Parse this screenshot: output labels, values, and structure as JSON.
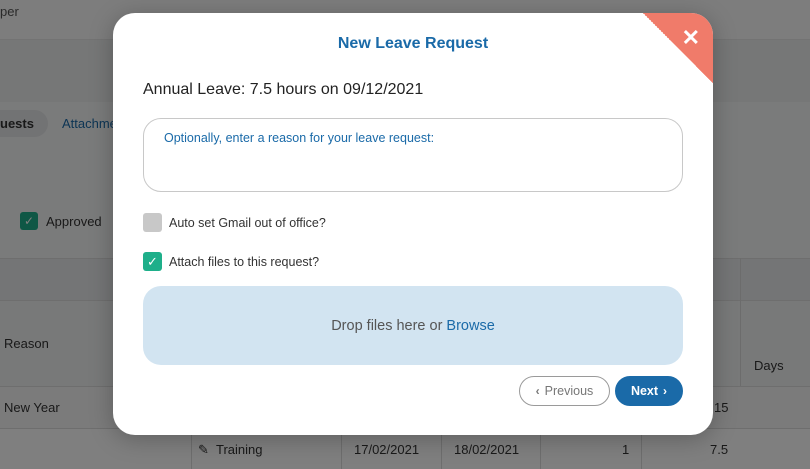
{
  "background": {
    "top_text": "per",
    "tabs": {
      "requests": "uests",
      "attachments": "Attachme"
    },
    "filter": {
      "approved_label": "Approved",
      "check_glyph": "✓"
    },
    "table": {
      "col_reason": "Reason",
      "col_days": "Days",
      "rows": [
        {
          "reason": "New Year",
          "days": "15"
        },
        {
          "reason": "Training",
          "start": "17/02/2021",
          "end": "18/02/2021",
          "count": "1",
          "days": "7.5"
        }
      ]
    }
  },
  "modal": {
    "title": "New Leave Request",
    "close_glyph": "✕",
    "leave_summary": "Annual Leave: 7.5 hours on 09/12/2021",
    "reason_placeholder": "Optionally, enter a reason for your leave request:",
    "options": {
      "gmail_ooo": {
        "label": "Auto set Gmail out of office?",
        "checked": false
      },
      "attach_files": {
        "label": "Attach files to this request?",
        "checked": true,
        "check_glyph": "✓"
      }
    },
    "dropzone": {
      "text": "Drop files here or",
      "browse": "Browse"
    },
    "buttons": {
      "previous": "Previous",
      "previous_icon": "‹",
      "next": "Next",
      "next_icon": "›"
    },
    "colors": {
      "accent": "#1a6aa8",
      "close_corner": "#f07b6a",
      "checked": "#1eaf8a",
      "dropzone": "#d2e4f1"
    }
  }
}
